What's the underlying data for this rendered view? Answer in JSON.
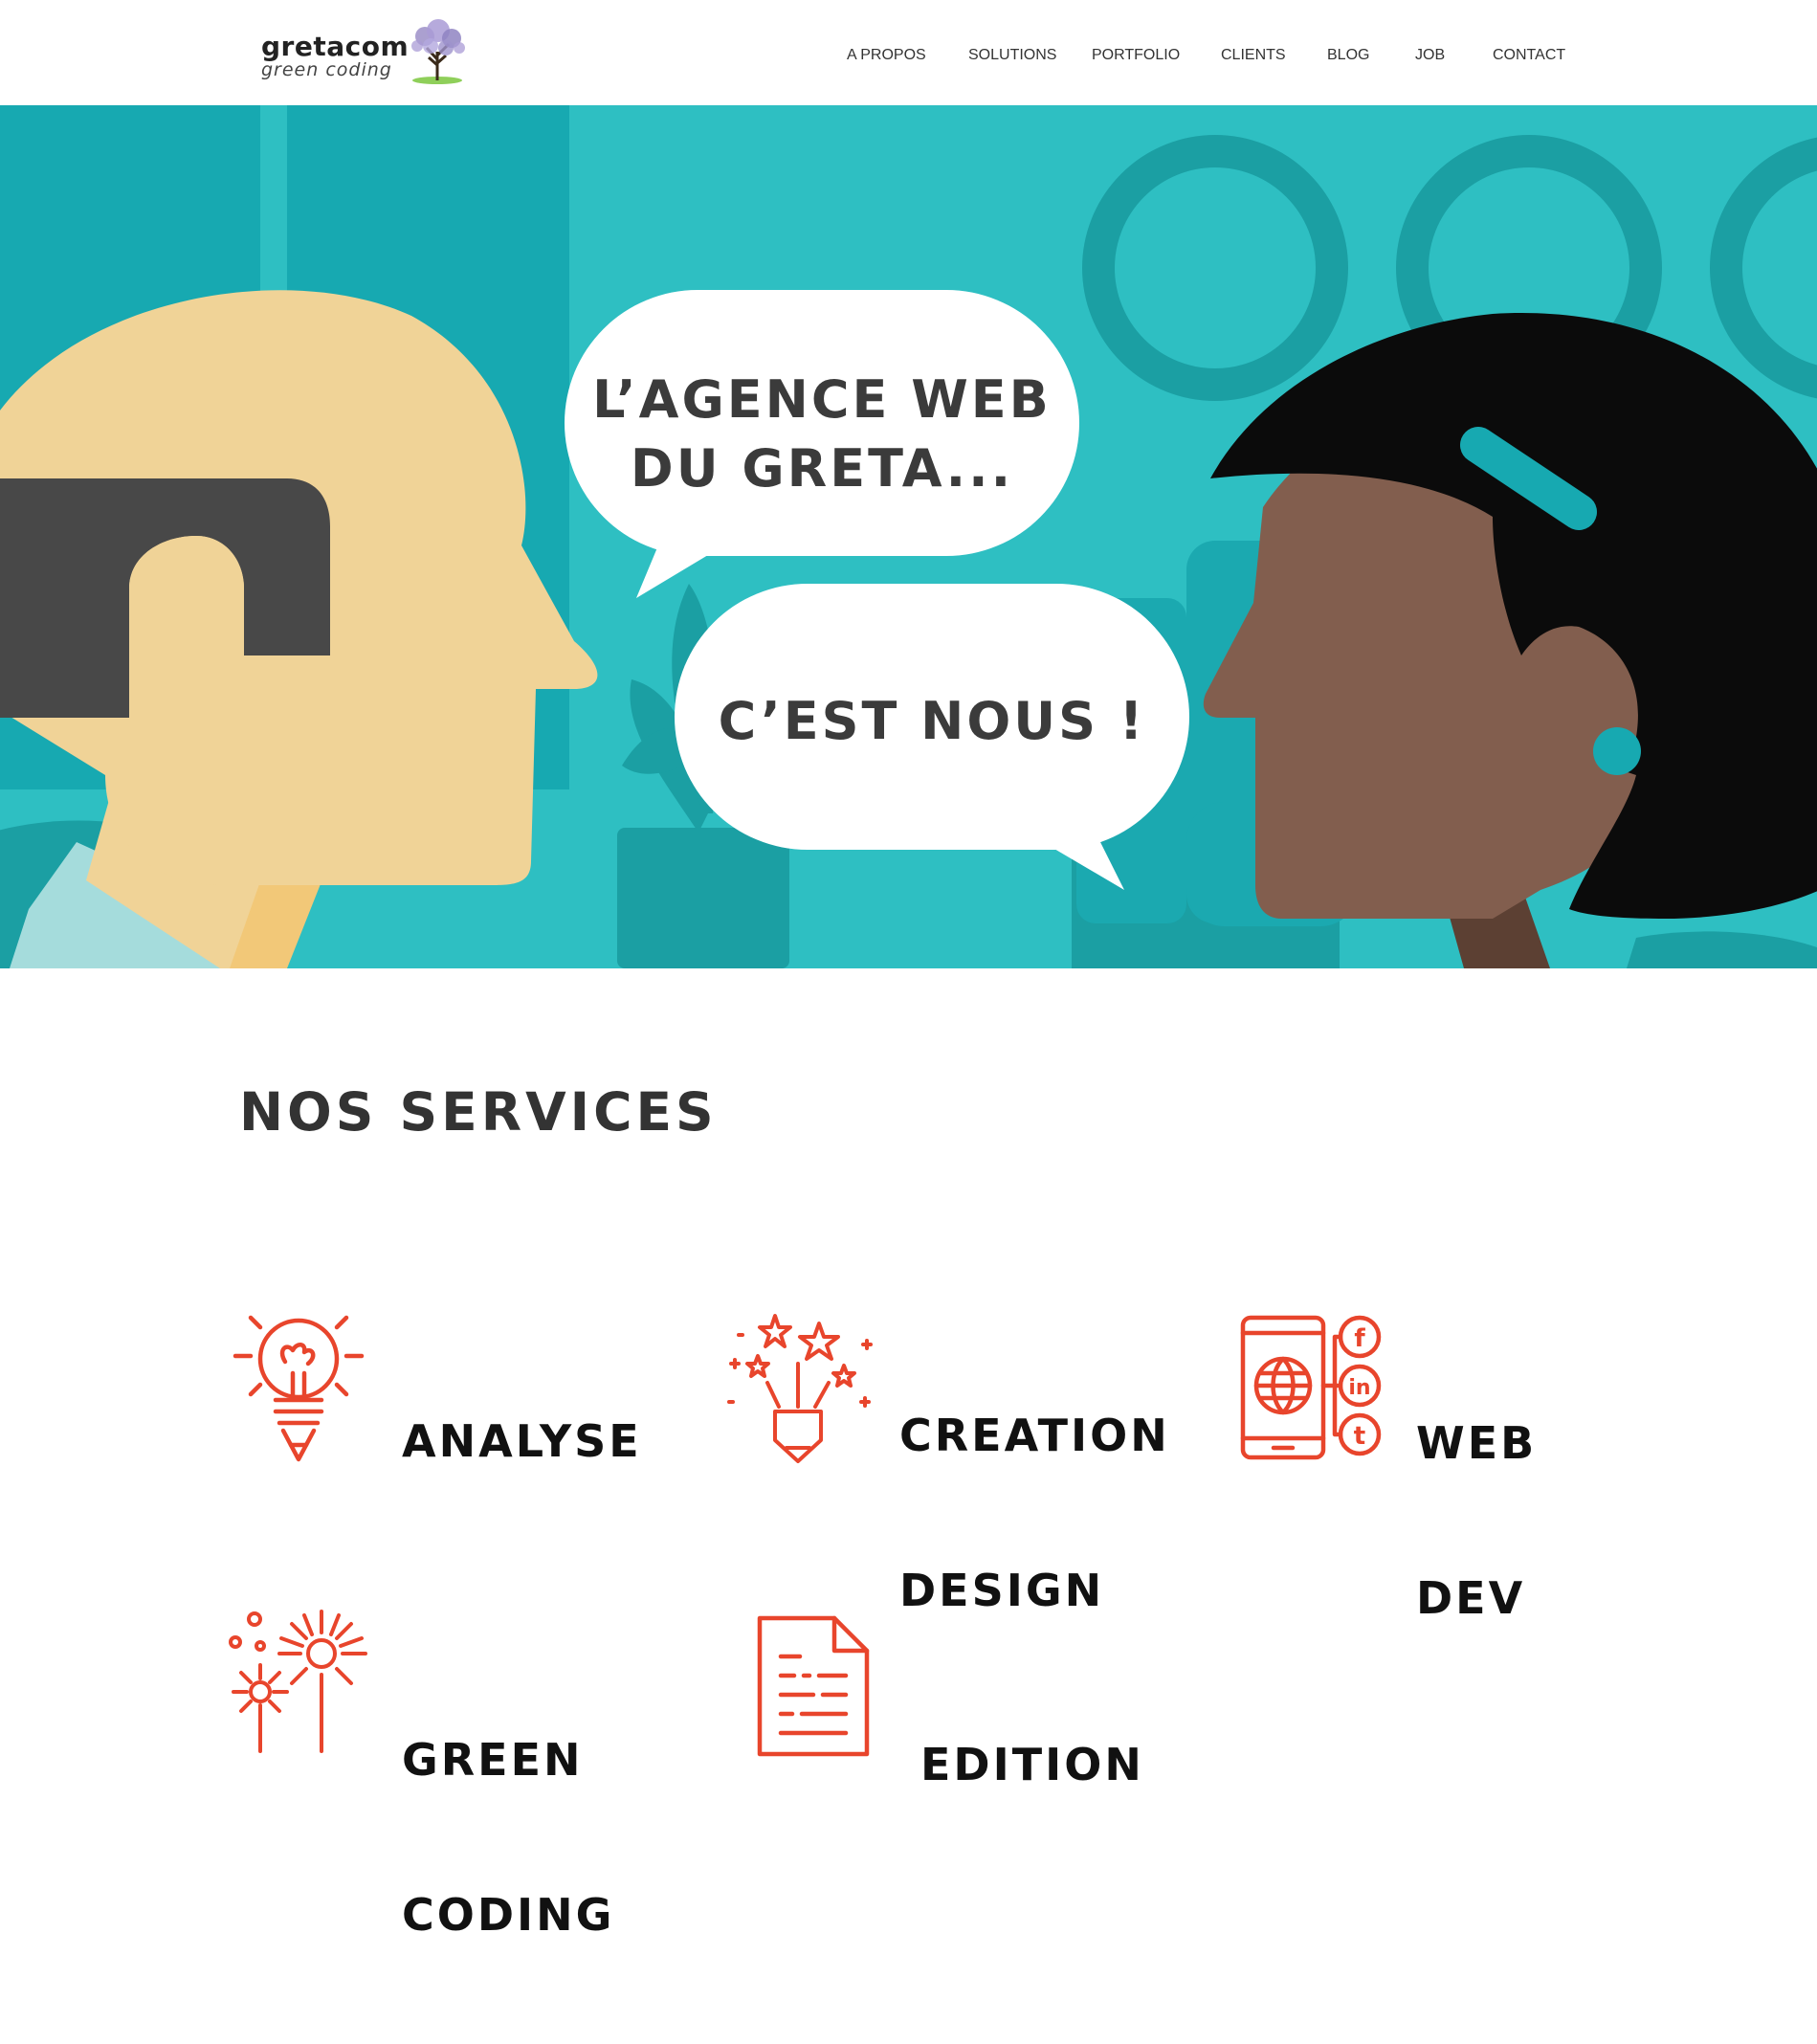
{
  "header": {
    "logo": {
      "title": "gretacom",
      "subtitle": "green coding"
    },
    "nav": [
      {
        "label": "A PROPOS"
      },
      {
        "label": "SOLUTIONS"
      },
      {
        "label": "PORTFOLIO"
      },
      {
        "label": "CLIENTS"
      },
      {
        "label": "BLOG"
      },
      {
        "label": "JOB"
      },
      {
        "label": "CONTACT"
      }
    ]
  },
  "hero": {
    "bubble1": {
      "line1": "L’AGENCE WEB",
      "line2": "DU GRETA..."
    },
    "bubble2": {
      "text": "C’EST NOUS !"
    },
    "colors": {
      "background": "#2ebfc2",
      "accent": "#17a9b1"
    }
  },
  "services": {
    "title": "NOS SERVICES",
    "accent_color": "#e8452c",
    "items": [
      {
        "line1": "ANALYSE",
        "line2": "",
        "icon": "lightbulb-pencil-icon"
      },
      {
        "line1": "CREATION",
        "line2": "DESIGN",
        "icon": "stars-pencil-icon"
      },
      {
        "line1": "WEB",
        "line2": "DEV",
        "icon": "mobile-social-icon"
      },
      {
        "line1": "GREEN",
        "line2": "CODING",
        "icon": "fireworks-icon"
      },
      {
        "line1": "EDITION",
        "line2": "",
        "icon": "document-icon"
      }
    ]
  }
}
